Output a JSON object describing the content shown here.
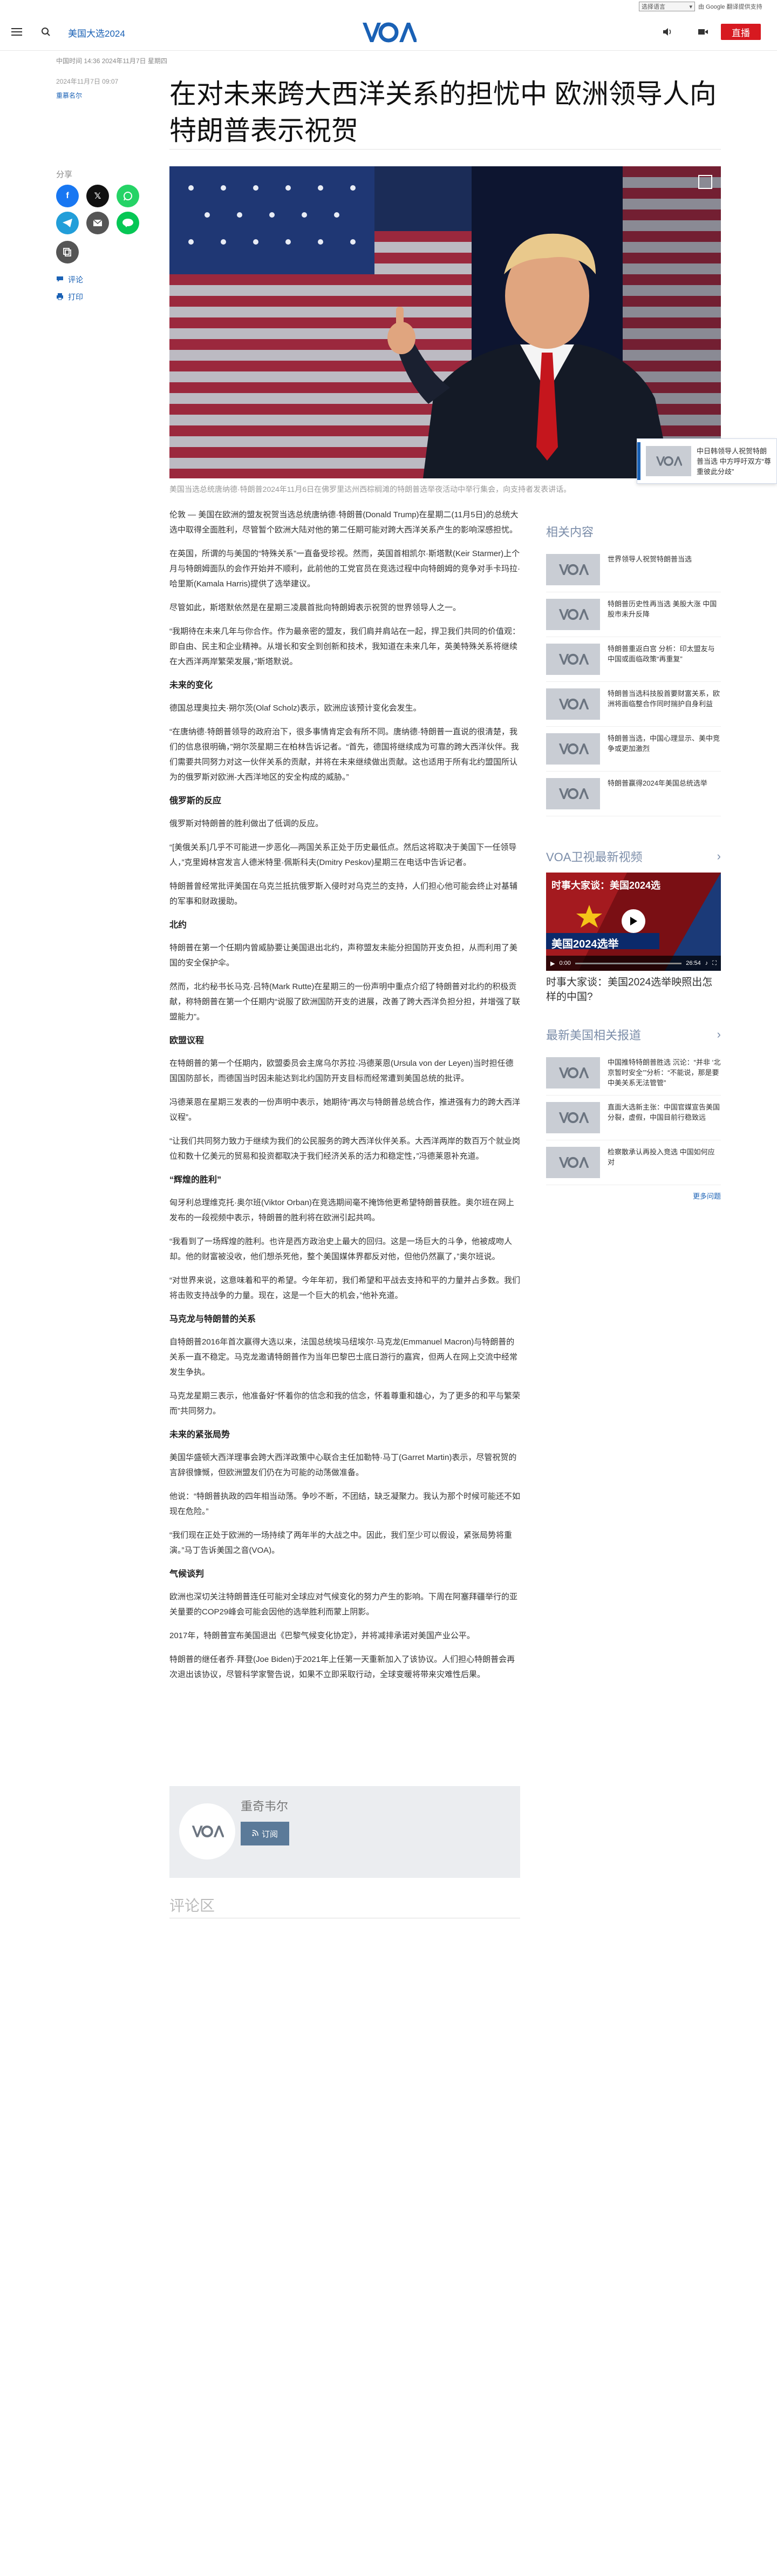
{
  "translate": {
    "select_label": "选择语言",
    "powered": "由 Google 翻译提供支持"
  },
  "header": {
    "section": "美国大选2024",
    "live_label": "直播"
  },
  "meta": {
    "line": "中国时间 14:36 2024年11月7日 星期四",
    "time": "2024年11月7日 09:07",
    "author": "重慕名尔"
  },
  "headline": "在对未来跨大西洋关系的担忧中 欧洲领导人向特朗普表示祝贺",
  "share": {
    "label": "分享",
    "comment_link": "评论",
    "print_link": "打印"
  },
  "caption": "美国当选总统唐纳德·特朗普2024年11月6日在佛罗里达州西棕榈滩的特朗普选举夜活动中举行集会，向支持者发表讲话。",
  "article": {
    "p1": "伦敦 — 美国在欧洲的盟友祝贺当选总统唐纳德·特朗普(Donald Trump)在星期二(11月5日)的总统大选中取得全面胜利，尽管暂个欧洲大陆对他的第二任期可能对跨大西洋关系产生的影响深感担忧。",
    "p2": "在英国，所谓的与美国的“特殊关系”一直备受珍视。然而，英国首相凯尔·斯塔默(Keir Starmer)上个月与特朗姆面队的会作开始并不顺利，此前他的工党官员在竞选过程中向特朗姆的竞争对手卡玛拉·哈里斯(Kamala Harris)提供了选举建议。",
    "p3": "尽管如此，斯塔默依然是在星期三凌晨首批向特朗姆表示祝贺的世界领导人之一。",
    "p4": "“我期待在未来几年与你合作。作为最亲密的盟友，我们肩并肩站在一起，捍卫我们共同的价值观：即自由、民主和企业精神。从增长和安全到创新和技术，我知道在未来几年，英美特殊关系将继续在大西洋两岸繁荣发展，”斯塔默说。",
    "h1": "未来的变化",
    "p5": "德国总理奥拉夫·朔尔茨(Olaf Scholz)表示，欧洲应该预计变化会发生。",
    "p6": "“在唐纳德·特朗普领导的政府治下，很多事情肯定会有所不同。唐纳德·特朗普一直说的很清楚，我们的信息很明确，”朔尔茨星期三在柏林告诉记者。“首先，德国将继续成为可靠的跨大西洋伙伴。我们需要共同努力对这一伙伴关系的贡献，并将在未来继续做出贡献。这也适用于所有北约盟国所认为的俄罗斯对欧洲-大西洋地区的安全构成的威胁。”",
    "h2": "俄罗斯的反应",
    "p7": "俄罗斯对特朗普的胜利做出了低调的反应。",
    "p8": "“[美俄关系]几乎不可能进一步恶化—两国关系正处于历史最低点。然后这将取决于美国下一任领导人，”克里姆林宫发言人德米特里·佩斯科夫(Dmitry Peskov)星期三在电话中告诉记者。",
    "p9": "特朗普曾经常批评美国在乌克兰抵抗俄罗斯入侵时对乌克兰的支持，人们担心他可能会终止对基辅的军事和财政援助。",
    "h3": "北约",
    "p10": "特朗普在第一个任期内曾威胁要让美国退出北约，声称盟友未能分担国防开支负担，从而利用了美国的安全保护伞。",
    "p11": "然而，北约秘书长马克·吕特(Mark Rutte)在星期三的一份声明中重点介绍了特朗普对北约的积极贡献，称特朗普在第一个任期内“说服了欧洲国防开支的进展，改善了跨大西洋负担分担，并增强了联盟能力”。",
    "h4": "欧盟议程",
    "p12": "在特朗普的第一个任期内，欧盟委员会主席乌尔苏拉·冯德莱恩(Ursula von der Leyen)当时担任德国国防部长，而德国当时因未能达到北约国防开支目标而经常遭到美国总统的批评。",
    "p13": "冯德莱恩在星期三发表的一份声明中表示，她期待“再次与特朗普总统合作，推进强有力的跨大西洋议程”。",
    "p14": "“让我们共同努力致力于继续为我们的公民服务的跨大西洋伙伴关系。大西洋两岸的数百万个就业岗位和数十亿美元的贸易和投资都取决于我们经济关系的活力和稳定性，”冯德莱恩补充道。",
    "h5": "“辉煌的胜利”",
    "p15": "匈牙利总理维克托·奥尔班(Viktor Orban)在竞选期间毫不掩饰他更希望特朗普获胜。奥尔班在网上发布的一段视频中表示，特朗普的胜利将在欧洲引起共鸣。",
    "p16": "“我看到了一场辉煌的胜利。也许是西方政治史上最大的回归。这是一场巨大的斗争，他被成吻人却。他的财富被没收，他们想杀死他，整个美国媒体界都反对他，但他仍然赢了，”奥尔班说。",
    "p17": "“对世界来说，这意味着和平的希望。今年年初，我们希望和平战去支持和平的力量并占多数。我们将击败支持战争的力量。现在，这是一个巨大的机会，”他补充道。",
    "h6": "马克龙与特朗普的关系",
    "p18": "自特朗普2016年首次赢得大选以来，法国总统埃马纽埃尔·马克龙(Emmanuel Macron)与特朗普的关系一直不稳定。马克龙邀请特朗普作为当年巴黎巴士底日游行的嘉宾，但两人在网上交流中经常发生争执。",
    "p19": "马克龙星期三表示，他准备好“怀着你的信念和我的信念，怀着尊重和雄心，为了更多的和平与繁荣而”共同努力。",
    "h7": "未来的紧张局势",
    "p20": "美国华盛顿大西洋理事会跨大西洋政策中心联合主任加勒特·马丁(Garret Martin)表示，尽管祝贺的言辞很慷慨，但欧洲盟友们仍在为可能的动荡做准备。",
    "p21": "他说：“特朗普执政的四年相当动荡。争吵不断，不团结，缺乏凝聚力。我认为那个时候可能还不如现在危险。”",
    "p22": "“我们现在正处于欧洲的一场持续了两年半的大战之中。因此，我们至少可以假设，紧张局势将重演。”马丁告诉美国之音(VOA)。",
    "h8": "气候谈判",
    "p23": "欧洲也深切关注特朗普连任可能对全球应对气候变化的努力产生的影响。下周在阿塞拜疆举行的亚关量要的COP29峰会可能会因他的选举胜利而蒙上阴影。",
    "p24": "2017年，特朗普宣布美国退出《巴黎气候变化协定》，并将减排承诺对美国产业公平。",
    "p25": "特朗普的继任者乔·拜登(Joe Biden)于2021年上任第一天重新加入了该协议。人们担心特朗普会再次退出该协议，尽管科学家警告说，如果不立即采取行动，全球变暖将带来灾难性后果。"
  },
  "author_box": {
    "name": "重奇韦尔",
    "subscribe": "订阅"
  },
  "comments_title": "评论区",
  "related": {
    "title": "相关内容",
    "items": [
      "世界领导人祝贺特朗普当选",
      "特朗普历史性再当选 美股大涨 中国股市未升反降",
      "特朗普重返白宫 分析：印太盟友与中国或面临政策“再重复”",
      "特朗普当选科技股首要财富关系，欧洲将面临整合作同时揣护自身利益",
      "特朗普当选，中国心理显示、美中竞争或更加激烈",
      "特朗普赢得2024年美国总统选举"
    ]
  },
  "video": {
    "title": "VOA卫视最新视频",
    "caption": "时事大家谈：美国2024选举映照出怎样的中国?",
    "overlay": "时事大家谈：美国2024选",
    "banner": "美国2024选举",
    "time_current": "0:00",
    "time_total": "26:54"
  },
  "latest": {
    "title": "最新美国相关报道",
    "items": [
      "中国推特特朗普胜选 沉论：“并非 ‘北京暂时安全’”分析：“不能说，那是要中美关系无法管管”",
      "直面大选新主张：中国官媒宣告美国分裂，虚假，中国目前行稳致远",
      "检察散承认再投入竞选 中国如何应对"
    ],
    "more": "更多问题"
  },
  "float_card": {
    "text": "中日韩领导人祝贺特朗普当选 中方呼吁双方“尊重彼此分歧”"
  },
  "colors": {
    "accent": "#1a61b5",
    "live": "#d71920",
    "brand": "#1a61b5"
  }
}
